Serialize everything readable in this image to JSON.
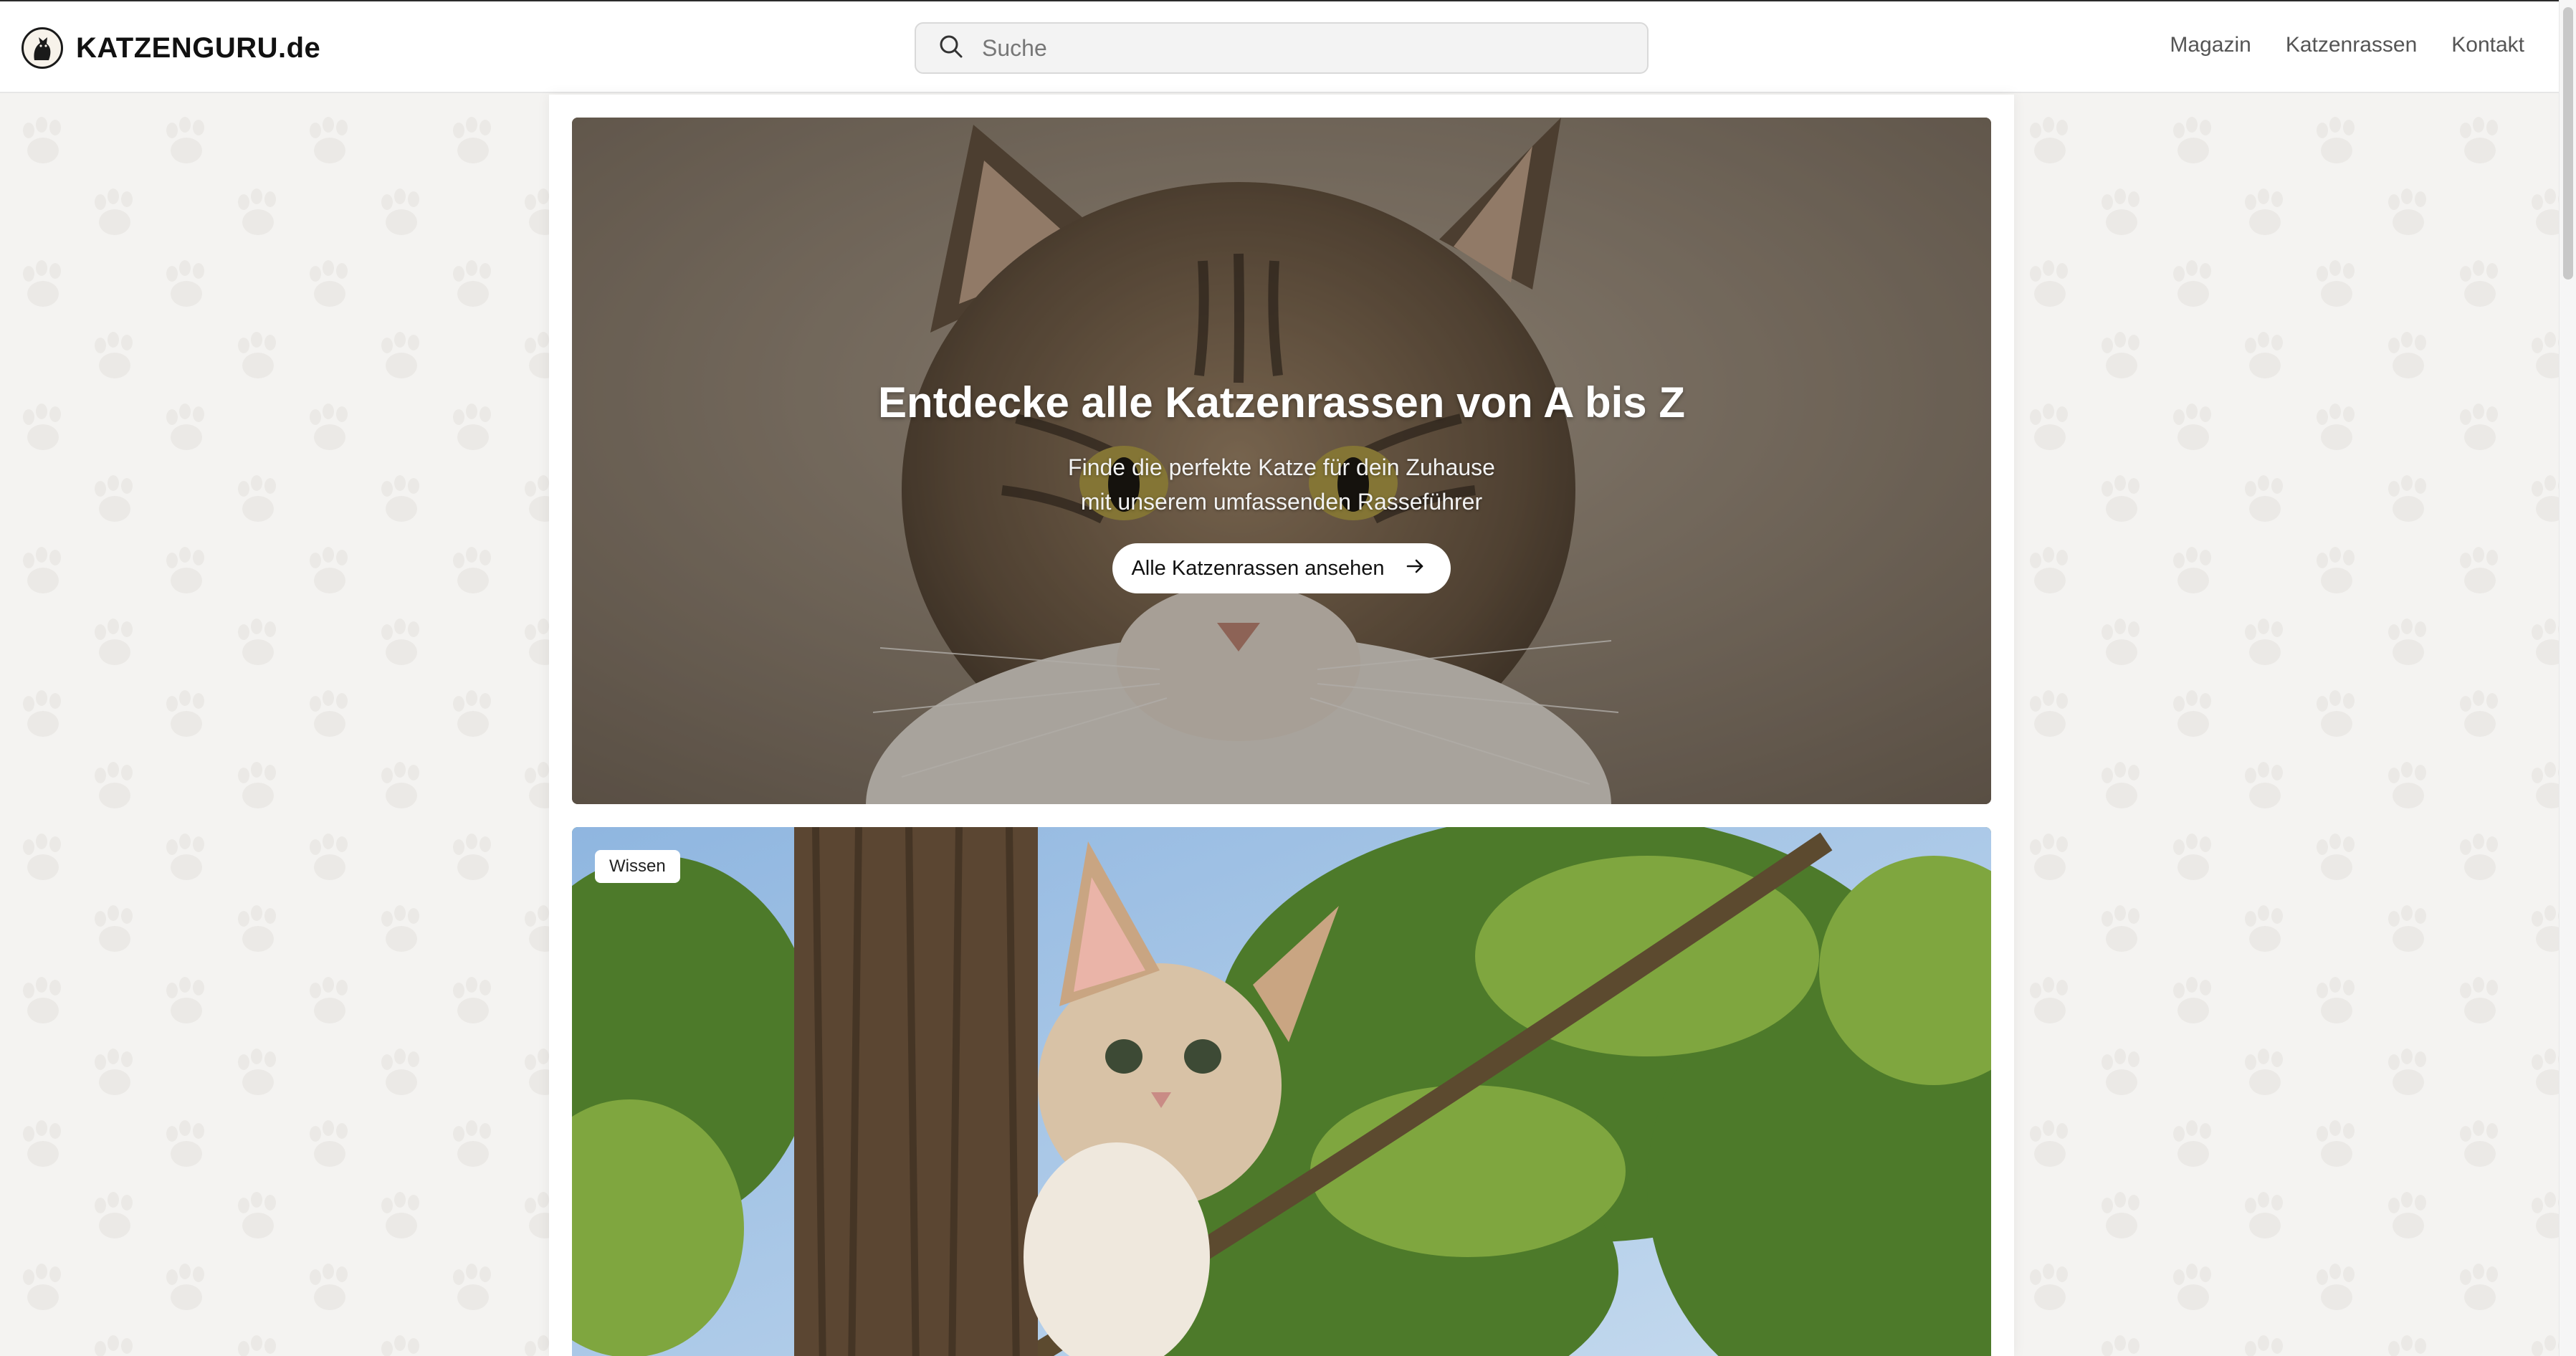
{
  "brand": {
    "name": "KATZENGURU.de"
  },
  "search": {
    "placeholder": "Suche"
  },
  "nav": {
    "items": [
      {
        "label": "Magazin"
      },
      {
        "label": "Katzenrassen"
      },
      {
        "label": "Kontakt"
      }
    ]
  },
  "hero": {
    "title": "Entdecke alle Katzenrassen von A bis Z",
    "subtitle_line1": "Finde die perfekte Katze für dein Zuhause",
    "subtitle_line2": "mit unserem umfassenden Rasseführer",
    "button_label": "Alle Katzenrassen ansehen",
    "button_icon": "arrow-right-icon"
  },
  "article_card": {
    "badge": "Wissen"
  },
  "colors": {
    "page_bg": "#f4f3f1",
    "header_bg": "#ffffff",
    "text_dark": "#111111",
    "nav_text": "#555555"
  }
}
